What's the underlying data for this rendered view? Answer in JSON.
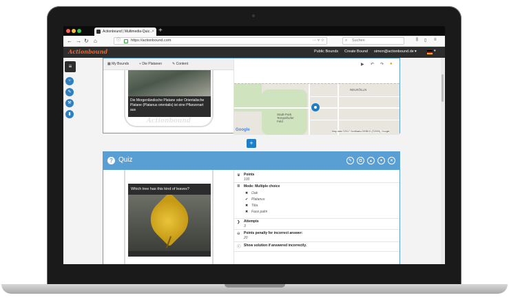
{
  "browser": {
    "tab_title": "Actionbound | Multimedia-Quiz...",
    "url": "https://actionbound.com",
    "search_placeholder": "Suchen"
  },
  "app": {
    "logo": "Actionbound",
    "menu": [
      "Public Bounds",
      "Create Bound",
      "simon@actionbound.de"
    ],
    "accent_color": "#e8662d",
    "primary_color": "#5a9fd4"
  },
  "toolbar": {
    "items": [
      "My Bounds",
      "Die Platanen",
      "Content"
    ]
  },
  "element1": {
    "caption": "Die Morgenländische Platane oder Orientalische Platane (Platanus orientalis) ist eine Pflanzenart aus",
    "phone_logo": "Actionbound"
  },
  "map": {
    "labels": [
      "NEUKÖLLN",
      "Stadt-Park Tempelhofer Feld"
    ],
    "provider": "Google",
    "copyright": "Map data ©2017 GeoBasis-DE/BKG (©2009), Google"
  },
  "quiz": {
    "title": "Quiz",
    "question": "Which tree has this kind of leaves?",
    "points_label": "Points",
    "points_value": "100",
    "mode_label": "Mode: Multiple choice",
    "answers": [
      {
        "text": "Oak",
        "correct": false
      },
      {
        "text": "Platanus",
        "correct": true
      },
      {
        "text": "Tilia",
        "correct": false
      },
      {
        "text": "Face palm",
        "correct": false
      }
    ],
    "attempts_label": "Attempts",
    "attempts_value": "3",
    "penalty_label": "Points penalty for incorrect answer:",
    "penalty_value": "20",
    "solution_label": "Show solution if answered incorrectly."
  }
}
